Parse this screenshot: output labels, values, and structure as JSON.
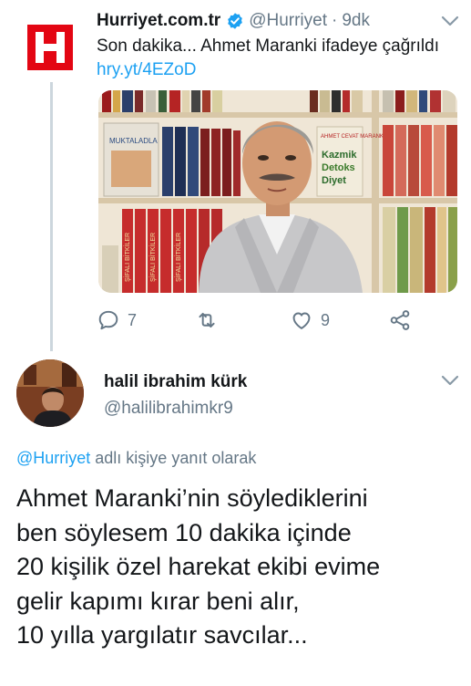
{
  "original_tweet": {
    "display_name": "Hurriyet.com.tr",
    "handle": "@Hurriyet",
    "separator": "·",
    "time": "9dk",
    "text": "Son dakika... Ahmet Maranki ifadeye çağrıldı ",
    "link": "hry.yt/4EZoD",
    "actions": {
      "reply_count": "7",
      "like_count": "9"
    },
    "media": {
      "book_covers": [
        "MUKTALADLA",
        "AHMET CEVAT MARANKİ",
        "Kazmik",
        "Detoks",
        "Diyet"
      ],
      "book_spine": "ŞİFALI BİTKİLER"
    }
  },
  "reply_tweet": {
    "display_name": "halil ibrahim kürk",
    "handle": "@halilibrahimkr9",
    "reply_to_mention": "@Hurriyet",
    "reply_to_suffix": " adlı kişiye yanıt olarak",
    "lines": [
      "Ahmet Maranki’nin söylediklerini",
      "ben söylesem 10 dakika içinde",
      "20 kişilik özel harekat ekibi evime",
      "gelir kapımı kırar beni alır,",
      "10 yılla yargılatır savcılar..."
    ]
  },
  "colors": {
    "link_blue": "#1da1f2",
    "muted_gray": "#657786",
    "text_dark": "#14171a",
    "brand_red": "#e30613"
  },
  "icons": [
    "chevron-down-icon",
    "verified-badge-icon",
    "reply-icon",
    "retweet-icon",
    "like-icon",
    "share-icon"
  ]
}
